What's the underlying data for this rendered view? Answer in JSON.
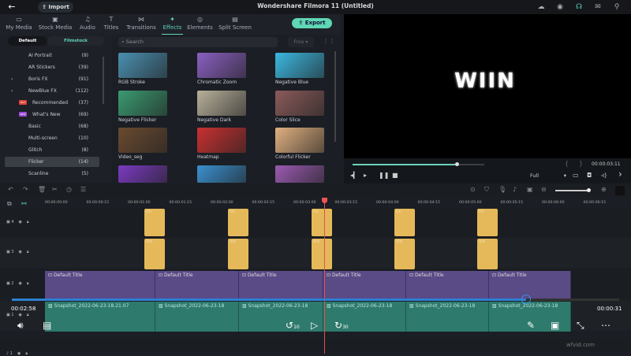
{
  "app": {
    "title": "Wondershare Filmora 11 (Untitled)",
    "import_label": "Import",
    "export_label": "Export",
    "top_icons": [
      "cloud-icon",
      "account-icon",
      "headset-icon",
      "mail-icon",
      "user-icon"
    ]
  },
  "nav": {
    "tabs": [
      {
        "label": "My Media",
        "icon": "media-icon"
      },
      {
        "label": "Stock Media",
        "icon": "stock-icon"
      },
      {
        "label": "Audio",
        "icon": "music-icon"
      },
      {
        "label": "Titles",
        "icon": "titles-icon"
      },
      {
        "label": "Transitions",
        "icon": "transitions-icon"
      },
      {
        "label": "Effects",
        "icon": "effects-icon",
        "active": true
      },
      {
        "label": "Elements",
        "icon": "elements-icon"
      },
      {
        "label": "Split Screen",
        "icon": "split-screen-icon"
      }
    ]
  },
  "library": {
    "segments": [
      "Default",
      "Filmstock"
    ],
    "categories": [
      {
        "label": "AI Portrait",
        "count": "(9)"
      },
      {
        "label": "AR Stickers",
        "count": "(39)"
      },
      {
        "label": "Boris FX",
        "count": "(91)",
        "expandable": true
      },
      {
        "label": "NewBlue FX",
        "count": "(112)",
        "expandable": true
      },
      {
        "label": "Recommended",
        "count": "(37)",
        "badge": "HOT"
      },
      {
        "label": "What's New",
        "count": "(69)",
        "badge": "NEW"
      },
      {
        "label": "Basic",
        "count": "(68)"
      },
      {
        "label": "Multi-screen",
        "count": "(10)"
      },
      {
        "label": "Glitch",
        "count": "(8)"
      },
      {
        "label": "Flicker",
        "count": "(14)",
        "selected": true
      },
      {
        "label": "Scanline",
        "count": "(5)"
      }
    ],
    "search_placeholder": "Search",
    "filter": "Free",
    "effects": [
      {
        "label": "RGB Stroke",
        "color": "#4a8fb0"
      },
      {
        "label": "Chromatic Zoom",
        "color": "#8a5fc0"
      },
      {
        "label": "Negative Blue",
        "color": "#3bb8e0"
      },
      {
        "label": "Negative Flicker",
        "color": "#3a9a70"
      },
      {
        "label": "Negative Dark",
        "color": "#b8b09a"
      },
      {
        "label": "Color Slice",
        "color": "#8a5a5a"
      },
      {
        "label": "Video_seg",
        "color": "#6a4a30"
      },
      {
        "label": "Heatmap",
        "color": "#c83030"
      },
      {
        "label": "Colorful Flicker",
        "color": "#e0b080"
      },
      {
        "label": "",
        "color": "#7a3ac0"
      },
      {
        "label": "",
        "color": "#3a90d0"
      },
      {
        "label": "",
        "color": "#9a5ab0"
      }
    ]
  },
  "preview": {
    "overlay_text": "WIIN",
    "timecode": "00:00:03:11",
    "quality": "Full",
    "progress": 0.6
  },
  "timeline": {
    "ruler": [
      "00:00:00:00",
      "00:00:00:15",
      "00:00:01:00",
      "00:00:01:15",
      "00:00:02:00",
      "00:00:02:15",
      "00:00:03:00",
      "00:00:03:15",
      "00:00:04:00",
      "00:00:04:15",
      "00:00:05:00",
      "00:00:05:15",
      "00:00:06:00",
      "00:00:06:15"
    ],
    "tracks": [
      {
        "label": "4"
      },
      {
        "label": "3"
      },
      {
        "label": "2"
      },
      {
        "label": "1"
      },
      {
        "label": "1"
      }
    ],
    "effect_clip_label_top": "Un",
    "effect_clip_label_bottom": "Vid",
    "title_clips": [
      "Default Title",
      "Default Title",
      "Default Title",
      "Default Title",
      "Default Title",
      "Default Title"
    ],
    "snapshot_clips": [
      "Snapshot_2022-06-23-18.21.07",
      "Snapshot_2022-06-23-18",
      "Snapshot_2022-06-23-18",
      "Snapshot_2022-06-23-18",
      "Snapshot_2022-06-23-18",
      "Snapshot_2022-06-23-18"
    ]
  },
  "overlay_player": {
    "elapsed": "00:02:58",
    "remaining": "00:00:31",
    "progress": 0.85,
    "skip_back": "10",
    "skip_forward": "30"
  },
  "watermark": "wfvid.com"
}
